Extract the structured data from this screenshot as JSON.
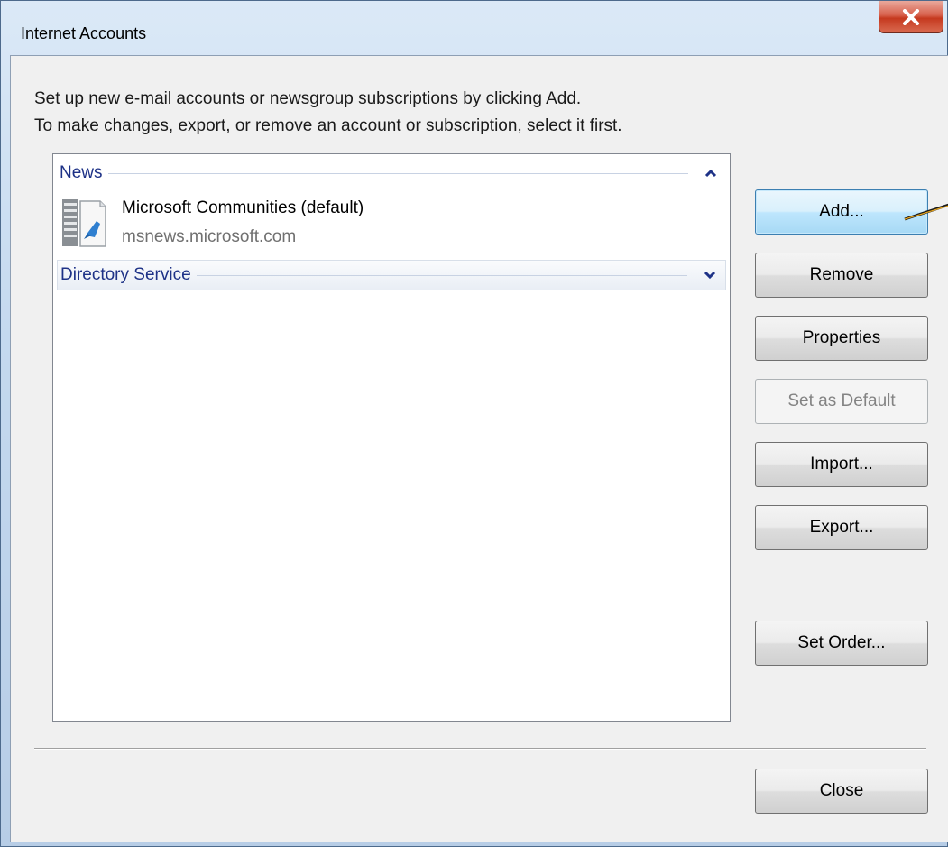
{
  "window": {
    "title": "Internet Accounts",
    "close_icon": "close-icon"
  },
  "instructions": {
    "line1": "Set up new e-mail accounts or newsgroup subscriptions by clicking Add.",
    "line2": "To make changes, export, or remove an account or subscription, select it first."
  },
  "accounts_list": {
    "groups": [
      {
        "label": "News",
        "expanded": true,
        "icon": "chevron-up-icon",
        "accounts": [
          {
            "name": "Microsoft Communities (default)",
            "server": "msnews.microsoft.com",
            "icon": "news-server-icon"
          }
        ]
      },
      {
        "label": "Directory Service",
        "expanded": false,
        "icon": "chevron-down-icon",
        "accounts": []
      }
    ]
  },
  "buttons": {
    "add": "Add...",
    "remove": "Remove",
    "properties": "Properties",
    "set_default": "Set as Default",
    "import": "Import...",
    "export": "Export...",
    "set_order": "Set Order...",
    "close": "Close"
  },
  "colors": {
    "group_header_text": "#1e3287",
    "focus_button": "#bee6fd",
    "close_button": "#c5391f"
  }
}
